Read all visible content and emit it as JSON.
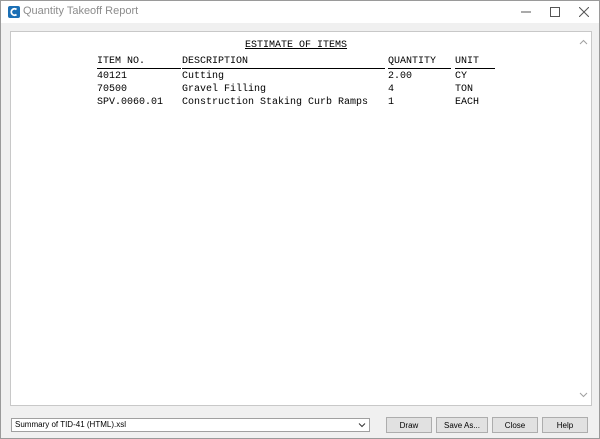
{
  "window": {
    "title": "Quantity Takeoff Report",
    "icon": "app-logo-icon",
    "controls": [
      "minimize-icon",
      "maximize-icon",
      "close-icon"
    ]
  },
  "report": {
    "title": "ESTIMATE OF ITEMS",
    "columns": {
      "item_no": "ITEM NO.",
      "description": "DESCRIPTION",
      "quantity": "QUANTITY",
      "unit": "UNIT"
    },
    "rows": [
      {
        "item_no": "40121",
        "description": "Cutting",
        "quantity": "2.00",
        "unit": "CY"
      },
      {
        "item_no": "70500",
        "description": "Gravel Filling",
        "quantity": "4",
        "unit": "TON"
      },
      {
        "item_no": "SPV.0060.01",
        "description": "Construction Staking Curb Ramps",
        "quantity": "1",
        "unit": "EACH"
      }
    ]
  },
  "footer": {
    "stylesheet_selected": "Summary of TID-41 (HTML).xsl",
    "buttons": {
      "draw": "Draw",
      "save_as": "Save As...",
      "close": "Close",
      "help": "Help"
    }
  },
  "colors": {
    "title_text": "#8c8c8c",
    "window_bg": "#f0f0f0",
    "button_bg": "#e1e1e1"
  }
}
